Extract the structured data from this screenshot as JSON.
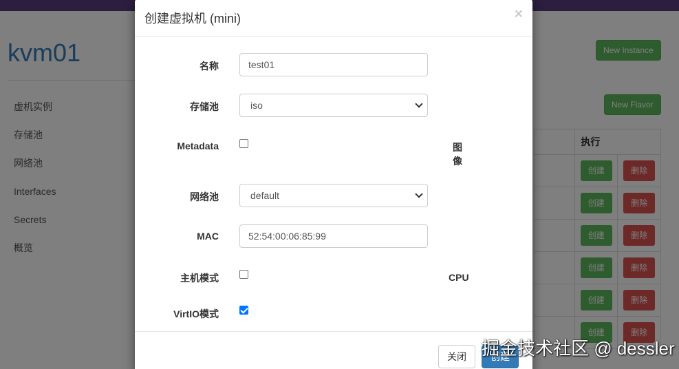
{
  "page": {
    "title": "kvm01",
    "sidebar": {
      "items": [
        {
          "label": "虚机实例"
        },
        {
          "label": "存储池"
        },
        {
          "label": "网络池"
        },
        {
          "label": "Interfaces"
        },
        {
          "label": "Secrets"
        },
        {
          "label": "概览"
        }
      ]
    },
    "buttons": {
      "new_instance": "New Instance",
      "new_flavor": "New Flavor"
    },
    "table": {
      "header_action": "执行",
      "rows": [
        {
          "create": "创建",
          "delete": "删除"
        },
        {
          "create": "创建",
          "delete": "删除"
        },
        {
          "create": "创建",
          "delete": "删除"
        },
        {
          "create": "创建",
          "delete": "删除"
        },
        {
          "create": "创建",
          "delete": "删除"
        },
        {
          "create": "创建",
          "delete": "删除"
        }
      ]
    }
  },
  "modal": {
    "title": "创建虚拟机 (mini)",
    "close_icon": "×",
    "fields": {
      "name": {
        "label": "名称",
        "value": "test01"
      },
      "storage_pool": {
        "label": "存储池",
        "value": "iso"
      },
      "metadata": {
        "label": "Metadata",
        "checked": false
      },
      "network_pool": {
        "label": "网络池",
        "value": "default"
      },
      "mac": {
        "label": "MAC",
        "value": "52:54:00:06:85:99"
      },
      "host_mode": {
        "label": "主机模式",
        "checked": false
      },
      "virtio_mode": {
        "label": "VirtIO模式",
        "checked": true
      }
    },
    "side_labels": {
      "image": "图像",
      "cpu": "CPU"
    },
    "footer": {
      "close_label": "关闭",
      "submit_label": "创建"
    }
  },
  "watermark": "掘金技术社区 @ dessler",
  "colors": {
    "primary": "#337ab7",
    "success": "#5cb85c",
    "danger": "#d9534f",
    "topbar": "#563d7c",
    "checkbox_checked": "#0075ff"
  }
}
